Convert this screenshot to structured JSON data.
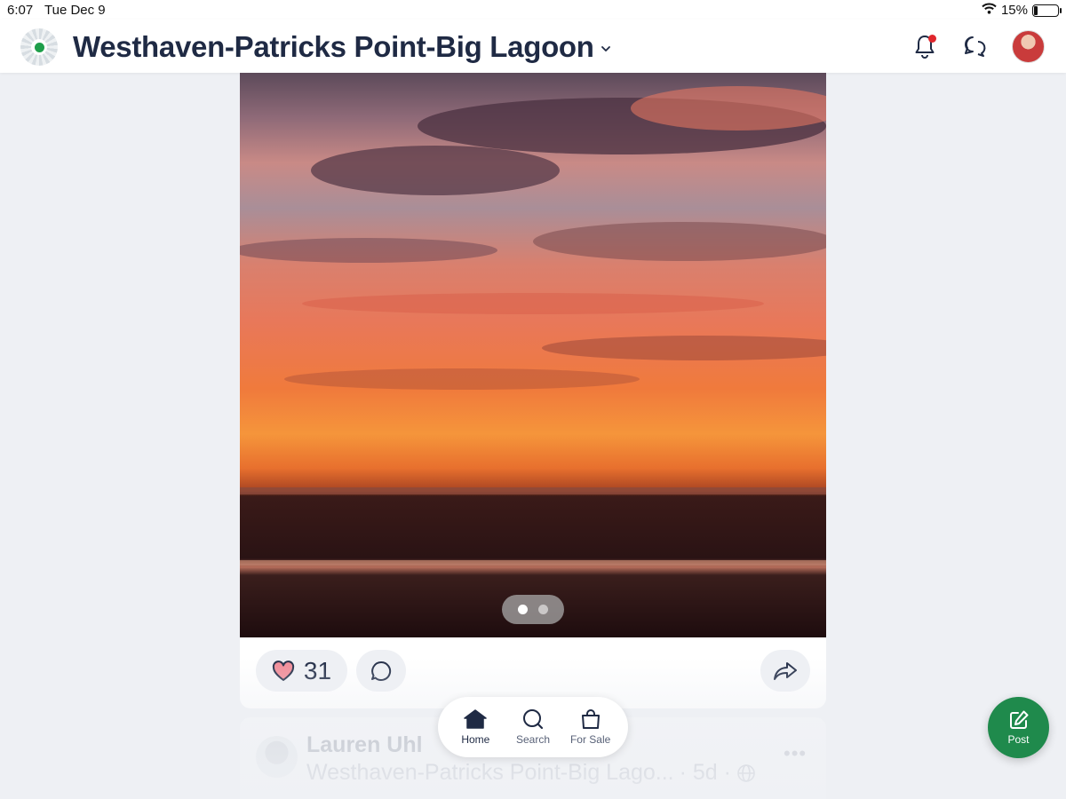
{
  "status_bar": {
    "time": "6:07",
    "date": "Tue Dec 9",
    "battery": "15%",
    "battery_level": 0.15
  },
  "header": {
    "title": "Westhaven-Patricks Point-Big Lagoon",
    "has_unread_notifications": true
  },
  "post": {
    "image_count": 2,
    "active_image_index": 0,
    "like_count": "31"
  },
  "next_post": {
    "author": "Lauren Uhl",
    "group": "Westhaven-Patricks Point-Big Lago...",
    "age": "· 5d ·",
    "more_label": "•••"
  },
  "bottom_nav": {
    "items": [
      {
        "label": "Home",
        "icon": "home-icon",
        "active": true
      },
      {
        "label": "Search",
        "icon": "search-icon",
        "active": false
      },
      {
        "label": "For Sale",
        "icon": "shopping-bag-icon",
        "active": false
      }
    ]
  },
  "fab": {
    "label": "Post",
    "icon": "compose-icon"
  },
  "colors": {
    "brand_green": "#1f8a4c",
    "notification_red": "#e0262c",
    "like_heart": "#f08a96",
    "text_dark": "#1f2a44",
    "background": "#eef0f4"
  }
}
